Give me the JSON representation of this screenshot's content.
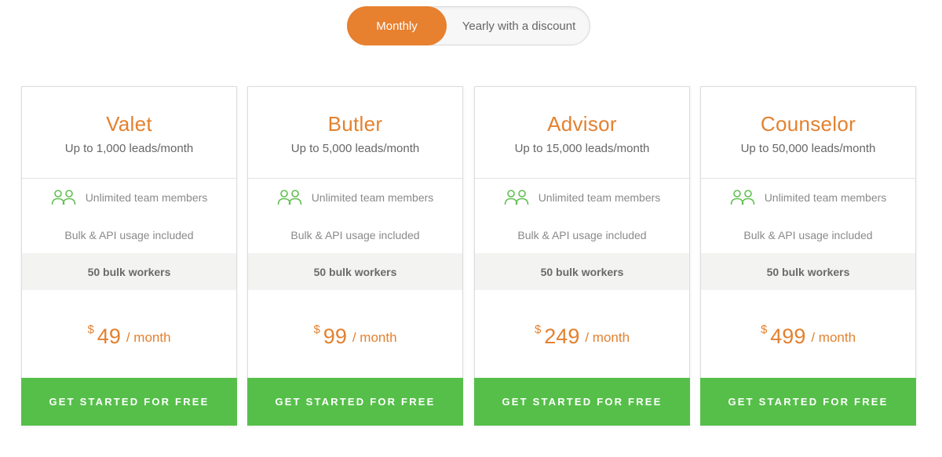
{
  "billing_toggle": {
    "monthly_label": "Monthly",
    "yearly_label": "Yearly with a discount",
    "selected": "Monthly",
    "accent_color": "#e7802f"
  },
  "plans": [
    {
      "name": "Valet",
      "limit": "Up to 1,000 leads/month",
      "features": [
        "Unlimited team members",
        "Bulk & API usage included",
        "50 bulk workers"
      ],
      "currency": "$",
      "price": "49",
      "period": "/ month",
      "cta": "GET STARTED FOR FREE"
    },
    {
      "name": "Butler",
      "limit": "Up to 5,000 leads/month",
      "features": [
        "Unlimited team members",
        "Bulk & API usage included",
        "50 bulk workers"
      ],
      "currency": "$",
      "price": "99",
      "period": "/ month",
      "cta": "GET STARTED FOR FREE"
    },
    {
      "name": "Advisor",
      "limit": "Up to 15,000 leads/month",
      "features": [
        "Unlimited team members",
        "Bulk & API usage included",
        "50 bulk workers"
      ],
      "currency": "$",
      "price": "249",
      "period": "/ month",
      "cta": "GET STARTED FOR FREE"
    },
    {
      "name": "Counselor",
      "limit": "Up to 50,000 leads/month",
      "features": [
        "Unlimited team members",
        "Bulk & API usage included",
        "50 bulk workers"
      ],
      "currency": "$",
      "price": "499",
      "period": "/ month",
      "cta": "GET STARTED FOR FREE"
    }
  ],
  "icons": {
    "team": "team-members-icon"
  },
  "colors": {
    "plan_accent": "#e3812f",
    "cta_green": "#56bf4a",
    "icon_green": "#5fbf4f"
  }
}
